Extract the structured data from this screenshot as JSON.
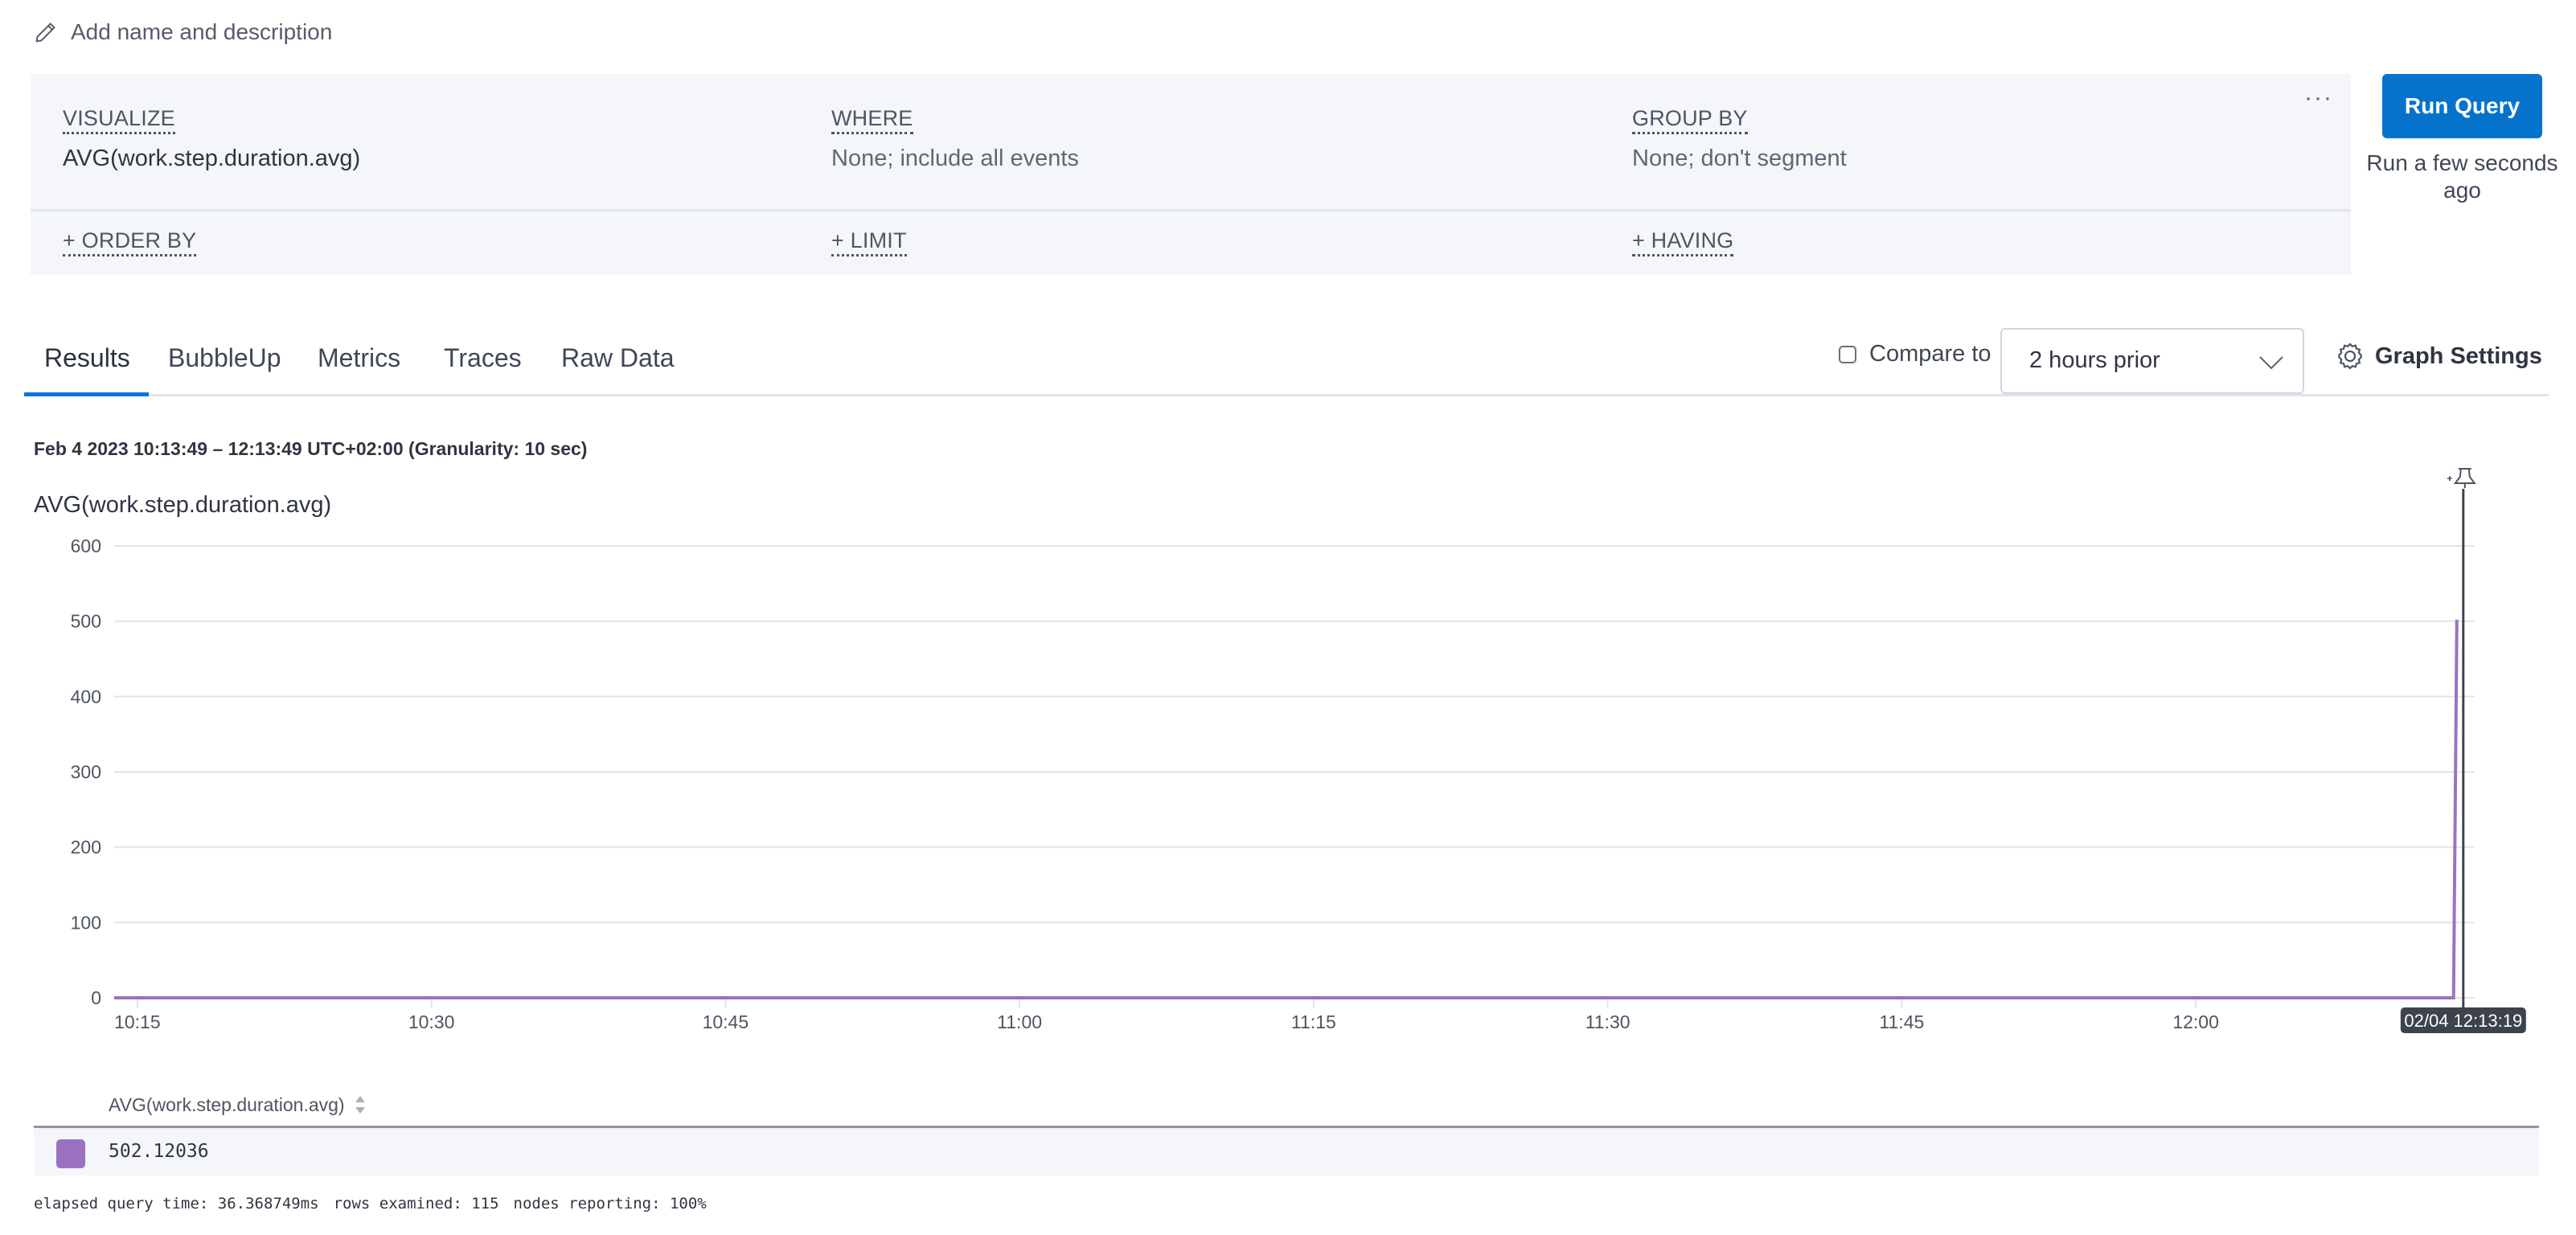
{
  "header": {
    "title_action": "Add name and description",
    "title_icon": "pencil-icon"
  },
  "query_builder": {
    "visualize": {
      "label": "VISUALIZE",
      "value": "AVG(work.step.duration.avg)"
    },
    "where": {
      "label": "WHERE",
      "value": "None; include all events"
    },
    "group_by": {
      "label": "GROUP BY",
      "value": "None; don't segment"
    },
    "order_by": {
      "label": "+ ORDER BY"
    },
    "limit": {
      "label": "+ LIMIT"
    },
    "having": {
      "label": "+ HAVING"
    },
    "more_label": "···"
  },
  "run": {
    "button_label": "Run Query",
    "status": "Run a few seconds ago",
    "accent": "#0573cc"
  },
  "tabs": [
    {
      "label": "Results",
      "active": true
    },
    {
      "label": "BubbleUp",
      "active": false
    },
    {
      "label": "Metrics",
      "active": false
    },
    {
      "label": "Traces",
      "active": false
    },
    {
      "label": "Raw Data",
      "active": false
    }
  ],
  "controls": {
    "compare_label": "Compare to",
    "compare_checked": false,
    "compare_option": "2 hours prior",
    "graph_settings_label": "Graph Settings"
  },
  "results": {
    "time_range": "Feb 4 2023 10:13:49 – 12:13:49 UTC+02:00 (Granularity: 10 sec)",
    "chart_title": "AVG(work.step.duration.avg)"
  },
  "chart_data": {
    "type": "line",
    "title": "AVG(work.step.duration.avg)",
    "xlabel": "",
    "ylabel": "",
    "x_range": [
      "10:13:49",
      "12:13:49"
    ],
    "ylim": [
      0,
      600
    ],
    "y_ticks": [
      0,
      100,
      200,
      300,
      400,
      500,
      600
    ],
    "x_ticks": [
      "10:15",
      "10:30",
      "10:45",
      "11:00",
      "11:15",
      "11:30",
      "11:45",
      "12:00"
    ],
    "grid": true,
    "series": [
      {
        "name": "AVG(work.step.duration.avg)",
        "color": "#9b72c1",
        "points": [
          {
            "t": "10:13:49",
            "v": 0
          },
          {
            "t": "12:13:09",
            "v": 0
          },
          {
            "t": "12:13:19",
            "v": 502.12036
          }
        ]
      }
    ],
    "crosshair": {
      "label": "02/04 12:13:19",
      "time": "12:13:19"
    }
  },
  "legend": {
    "column_header": "AVG(work.step.duration.avg)",
    "rows": [
      {
        "color": "#9b72c1",
        "value": "502.12036"
      }
    ]
  },
  "footer": {
    "elapsed": "elapsed query time: 36.368749ms",
    "rows": "rows examined: 115",
    "nodes": "nodes reporting: 100%"
  }
}
